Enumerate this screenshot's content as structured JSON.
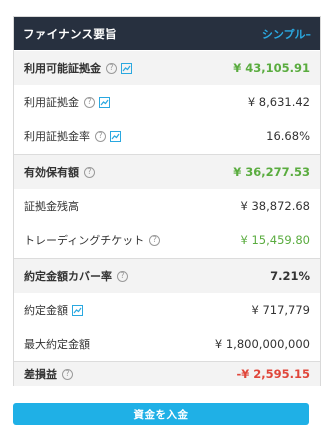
{
  "header": {
    "title": "ファイナンス要旨",
    "mode_label": "シンプル–"
  },
  "rows": [
    {
      "label": "利用可能証拠金",
      "value": "¥ 43,105.91"
    },
    {
      "label": "利用証拠金",
      "value": "¥ 8,631.42"
    },
    {
      "label": "利用証拠金率",
      "value": "16.68%"
    },
    {
      "label": "有効保有額",
      "value": "¥ 36,277.53"
    },
    {
      "label": "証拠金残高",
      "value": "¥ 38,872.68"
    },
    {
      "label": "トレーディングチケット",
      "value": "¥ 15,459.80"
    },
    {
      "label": "約定金額カバー率",
      "value": "7.21%"
    },
    {
      "label": "約定金額",
      "value": "¥ 717,779"
    },
    {
      "label": "最大約定金額",
      "value": "¥ 1,800,000,000"
    },
    {
      "label": "差損益",
      "value": "-¥ 2,595.15"
    }
  ],
  "deposit_button": "資金を入金",
  "icons": {
    "help": "?",
    "chart": "chart-icon"
  },
  "colors": {
    "header_bg": "#27303f",
    "accent": "#1fb0e6",
    "positive": "#5aac3f",
    "negative": "#e0463a"
  }
}
